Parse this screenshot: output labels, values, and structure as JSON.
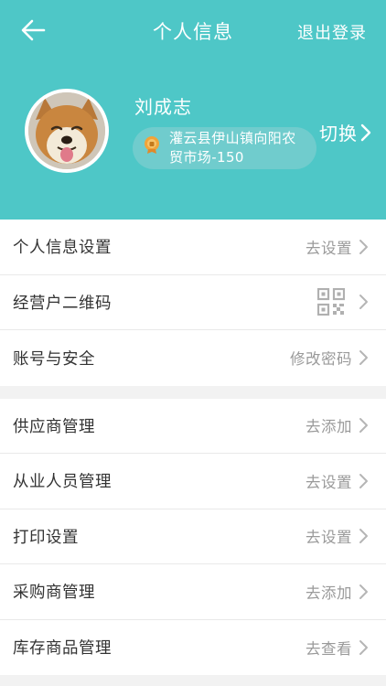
{
  "topbar": {
    "title": "个人信息",
    "logout_label": "退出登录"
  },
  "profile": {
    "name": "刘成志",
    "market": "灌云县伊山镇向阳农贸市场-150",
    "switch_label": "切换"
  },
  "group1": [
    {
      "label": "个人信息设置",
      "value": "去设置"
    },
    {
      "label": "经营户二维码",
      "value": ""
    },
    {
      "label": "账号与安全",
      "value": "修改密码"
    }
  ],
  "group2": [
    {
      "label": "供应商管理",
      "value": "去添加"
    },
    {
      "label": "从业人员管理",
      "value": "去设置"
    },
    {
      "label": "打印设置",
      "value": "去设置"
    },
    {
      "label": "采购商管理",
      "value": "去添加"
    },
    {
      "label": "库存商品管理",
      "value": "去查看"
    }
  ],
  "colors": {
    "header": "#4ec7c7",
    "market_pill": "#70cccd",
    "badge": "#f0a43a"
  }
}
